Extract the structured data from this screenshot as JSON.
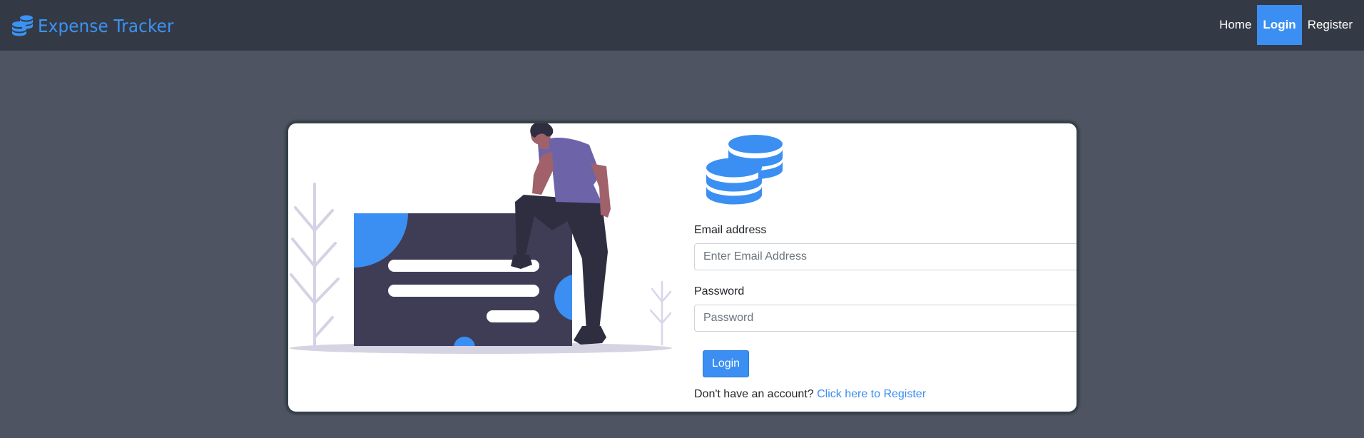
{
  "app": {
    "brand_name": "Expense Tracker",
    "brand_icon": "coins-icon",
    "accent_color": "#3b8ff3"
  },
  "nav": {
    "items": [
      {
        "label": "Home",
        "active": false
      },
      {
        "label": "Login",
        "active": true
      },
      {
        "label": "Register",
        "active": false
      }
    ]
  },
  "login_form": {
    "logo_icon": "coins-icon",
    "email_label": "Email address",
    "email_placeholder": "Enter Email Address",
    "email_value": "",
    "password_label": "Password",
    "password_placeholder": "Password",
    "password_value": "",
    "submit_label": "Login",
    "register_prompt": "Don't have an account?",
    "register_link": "Click here to Register"
  }
}
